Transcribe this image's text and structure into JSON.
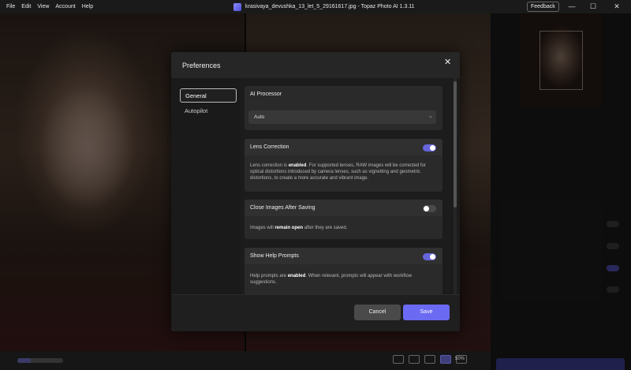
{
  "menu": [
    "File",
    "Edit",
    "View",
    "Account",
    "Help"
  ],
  "window": {
    "title": "krasivaya_devushka_13_let_5_29161617.jpg - Topaz Photo AI 1.3.11",
    "feedback_label": "Feedback",
    "minimize_glyph": "—",
    "maximize_glyph": "☐",
    "close_glyph": "✕"
  },
  "modal": {
    "title": "Preferences",
    "close_glyph": "✕",
    "sidebar": [
      {
        "label": "General",
        "active": true
      },
      {
        "label": "Autopilot",
        "active": false
      }
    ],
    "ai_processor": {
      "title": "AI Processor",
      "selected": "Auto",
      "chevron": "⌄"
    },
    "lens_correction": {
      "title": "Lens Correction",
      "enabled": true,
      "desc_before": "Lens correction is ",
      "desc_bold": "enabled",
      "desc_after": ". For supported lenses, RAW images will be corrected for optical distortions introduced by camera lenses, such as vignetting and geometric distortions, to create a more accurate and vibrant image."
    },
    "close_after_saving": {
      "title": "Close Images After Saving",
      "enabled": false,
      "desc_before": "Images will ",
      "desc_bold": "remain open",
      "desc_after": " after they are saved."
    },
    "help_prompts": {
      "title": "Show Help Prompts",
      "enabled": true,
      "desc_before": "Help prompts are ",
      "desc_bold": "enabled",
      "desc_after": ". When relevant, prompts will appear with workflow suggestions."
    },
    "cancel_label": "Cancel",
    "save_label": "Save"
  },
  "bottom": {
    "zoom": "50%"
  },
  "colors": {
    "accent": "#6a6af2",
    "toggle_on": "#6666dd"
  }
}
